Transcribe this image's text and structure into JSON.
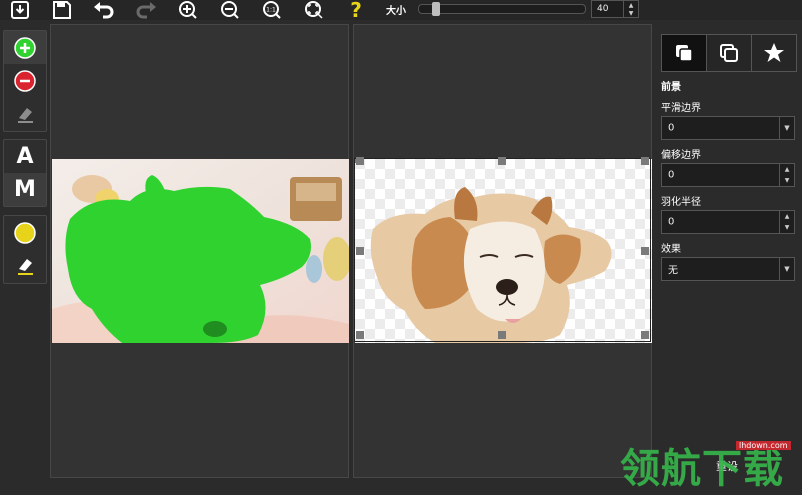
{
  "toolbar": {
    "icons": [
      "import-icon",
      "save-icon",
      "undo-icon",
      "redo-icon",
      "zoom-in-icon",
      "zoom-out-icon",
      "actual-size-icon",
      "fit-icon",
      "help-icon"
    ],
    "size_label": "大小",
    "size_value": "40",
    "size_fraction": 0.08
  },
  "left_tools": {
    "group1": [
      "add-green-icon",
      "remove-red-icon",
      "eraser-icon"
    ],
    "group2": {
      "a_label": "A",
      "m_label": "M"
    },
    "group3": [
      "yellow-brush-icon",
      "eraser-yellow-icon"
    ]
  },
  "right_panel": {
    "section_title": "前景",
    "smooth_label": "平滑边界",
    "smooth_value": "0",
    "offset_label": "偏移边界",
    "offset_value": "0",
    "feather_label": "羽化半径",
    "feather_value": "0",
    "effect_label": "效果",
    "effect_value": "无",
    "reset_label": "重设"
  },
  "watermark": {
    "text": "领航下载",
    "url": "lhdown.com"
  },
  "colors": {
    "accent_green": "#2fd22f",
    "background": "#2b2b2b",
    "remove_red": "#d9232e",
    "yellow": "#e6d31a"
  }
}
